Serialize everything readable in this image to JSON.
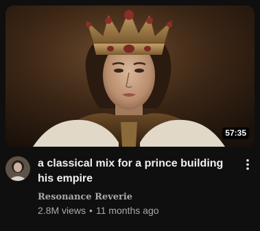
{
  "video": {
    "duration": "57:35",
    "title": "a classical mix for a prince building his empire",
    "channel": "Resonance Reverie",
    "views": "2.8M views",
    "separator": "•",
    "age": "11 months ago"
  },
  "icons": {
    "thumbnail": "prince-portrait-thumbnail",
    "avatar": "channel-avatar",
    "menu": "kebab-menu-icon"
  },
  "colors": {
    "background": "#0f0f0f",
    "title": "#f1f1f1",
    "secondary": "#aaaaaa",
    "duration_bg": "#000000cc"
  }
}
